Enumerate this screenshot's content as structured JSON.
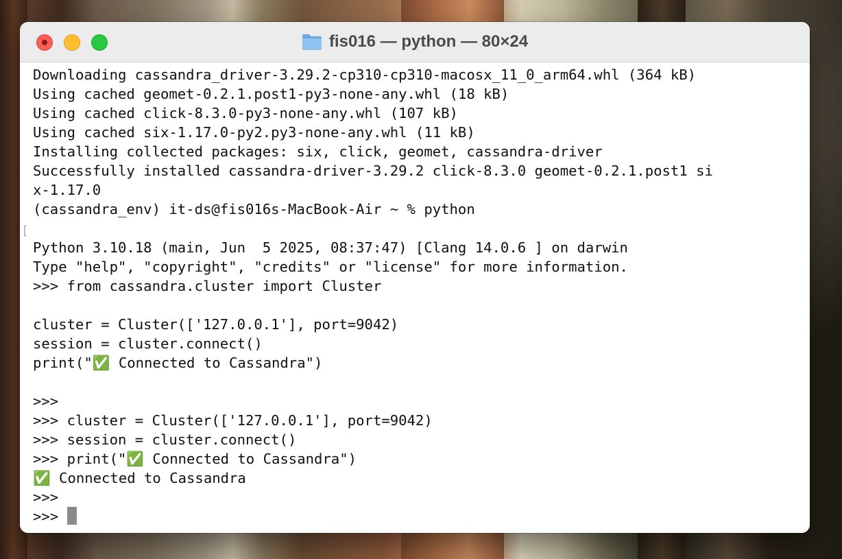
{
  "window": {
    "title": "fis016 — python — 80×24",
    "icon": "folder-icon"
  },
  "terminal": {
    "lines": [
      "Downloading cassandra_driver-3.29.2-cp310-cp310-macosx_11_0_arm64.whl (364 kB)",
      "Using cached geomet-0.2.1.post1-py3-none-any.whl (18 kB)",
      "Using cached click-8.3.0-py3-none-any.whl (107 kB)",
      "Using cached six-1.17.0-py2.py3-none-any.whl (11 kB)",
      "Installing collected packages: six, click, geomet, cassandra-driver",
      "Successfully installed cassandra-driver-3.29.2 click-8.3.0 geomet-0.2.1.post1 si",
      "x-1.17.0",
      "(cassandra_env) it-ds@fis016s-MacBook-Air ~ % python",
      "",
      "Python 3.10.18 (main, Jun  5 2025, 08:37:47) [Clang 14.0.6 ] on darwin",
      "Type \"help\", \"copyright\", \"credits\" or \"license\" for more information.",
      ">>> from cassandra.cluster import Cluster",
      "",
      "cluster = Cluster(['127.0.0.1'], port=9042)",
      "session = cluster.connect()",
      "print(\"✅ Connected to Cassandra\")",
      "",
      ">>>",
      ">>> cluster = Cluster(['127.0.0.1'], port=9042)",
      ">>> session = cluster.connect()",
      ">>> print(\"✅ Connected to Cassandra\")",
      "✅ Connected to Cassandra",
      ">>>"
    ],
    "prompt": ">>> ",
    "gutter_mark": "["
  },
  "colors": {
    "close": "#ff5f57",
    "minimize": "#febc2e",
    "zoom": "#28c840",
    "folder": "#7ab6e8"
  }
}
